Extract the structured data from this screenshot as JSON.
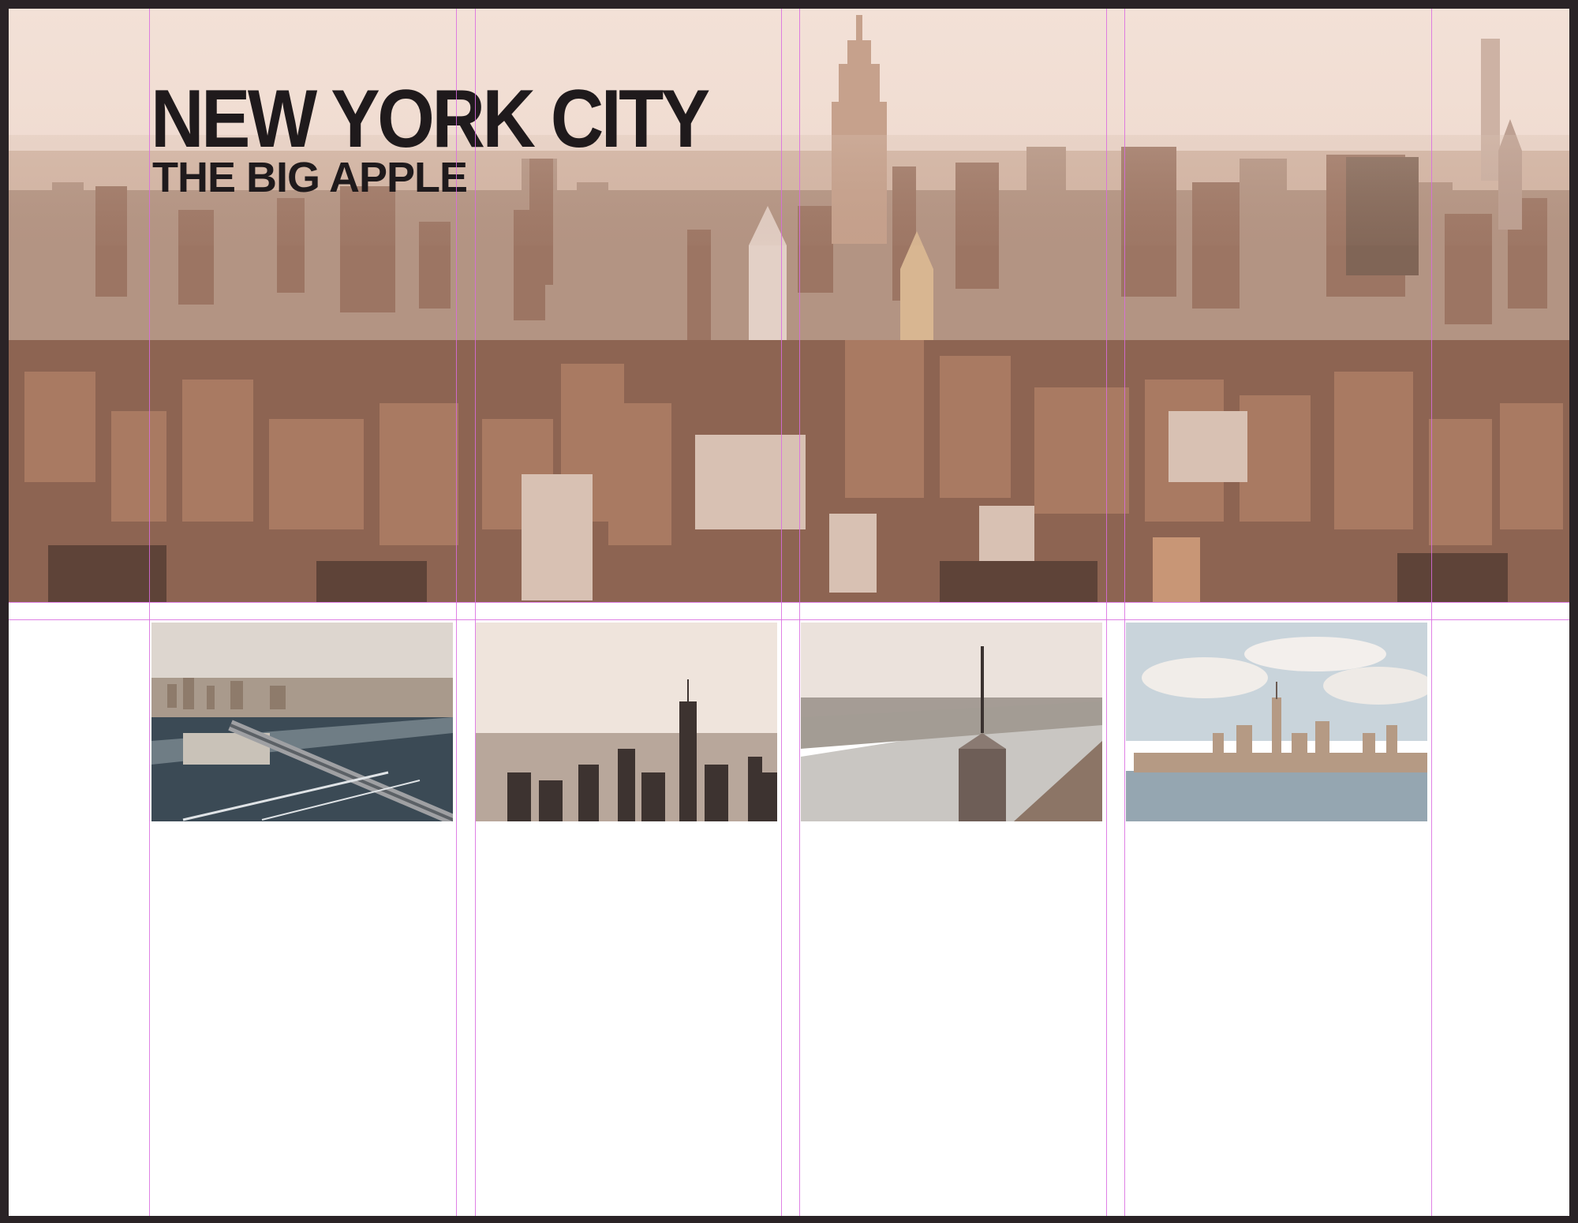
{
  "hero": {
    "headline": "NEW YORK CITY",
    "subheadline": "THE BIG APPLE"
  },
  "thumbnails": [
    {
      "name": "thumb-brooklyn-bridge-aerial"
    },
    {
      "name": "thumb-downtown-skyline-haze"
    },
    {
      "name": "thumb-one-wtc-spire-river"
    },
    {
      "name": "thumb-manhattan-skyline-water"
    }
  ],
  "colors": {
    "headline_text": "#1f1a1c",
    "guide_lines": "#d96be0",
    "canvas_background": "#2a2326",
    "page_background": "#ffffff"
  }
}
